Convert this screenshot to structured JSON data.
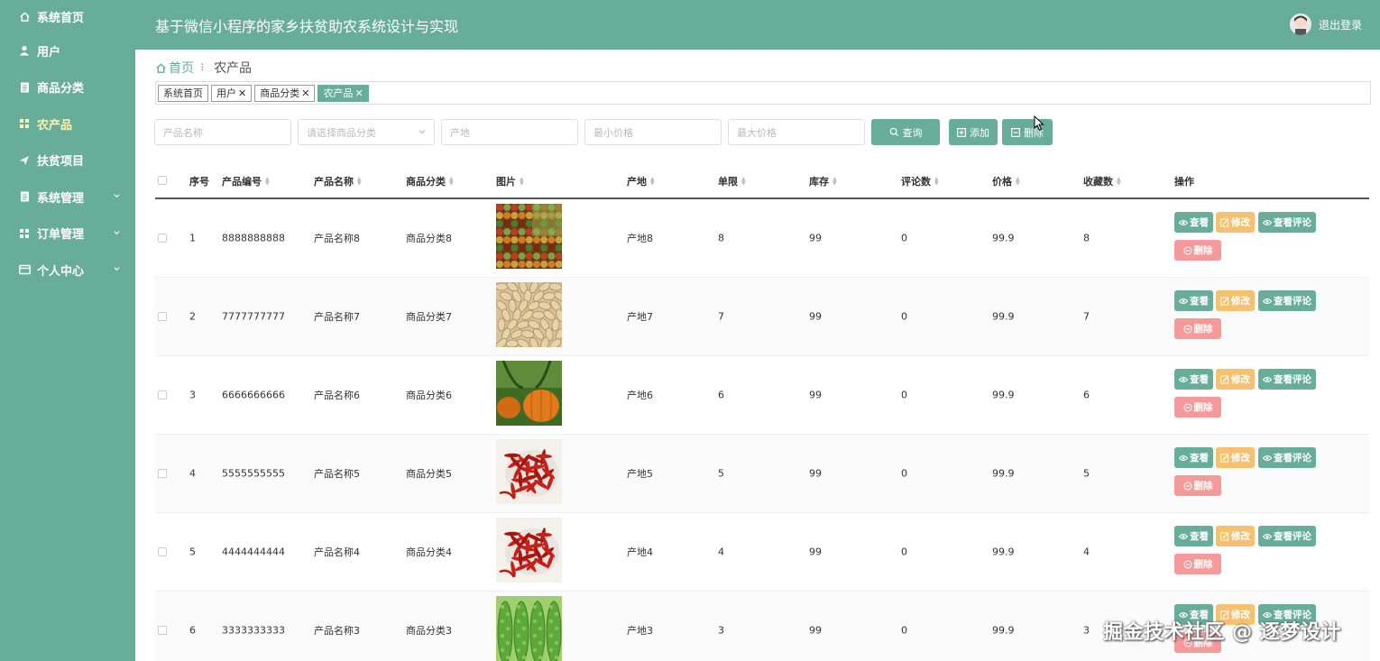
{
  "sidebar": {
    "items": [
      {
        "label": "系统首页",
        "icon": "home-icon",
        "active": false
      },
      {
        "label": "用户",
        "icon": "user-icon",
        "active": false
      },
      {
        "label": "商品分类",
        "icon": "doc-icon",
        "active": false
      },
      {
        "label": "农产品",
        "icon": "grid-icon",
        "active": true
      },
      {
        "label": "扶贫项目",
        "icon": "send-icon",
        "active": false
      },
      {
        "label": "系统管理",
        "icon": "doc-icon",
        "active": false,
        "expandable": true
      },
      {
        "label": "订单管理",
        "icon": "grid-icon",
        "active": false,
        "expandable": true
      },
      {
        "label": "个人中心",
        "icon": "card-icon",
        "active": false,
        "expandable": true
      }
    ]
  },
  "header": {
    "title": "基于微信小程序的家乡扶贫助农系统设计与实现",
    "logout": "退出登录"
  },
  "breadcrumb": {
    "home": "首页",
    "current": "农产品"
  },
  "tags": [
    {
      "label": "系统首页",
      "closable": false,
      "active": false
    },
    {
      "label": "用户",
      "closable": true,
      "active": false
    },
    {
      "label": "商品分类",
      "closable": true,
      "active": false
    },
    {
      "label": "农产品",
      "closable": true,
      "active": true
    }
  ],
  "search": {
    "name_placeholder": "产品名称",
    "category_placeholder": "请选择商品分类",
    "origin_placeholder": "产地",
    "min_price_placeholder": "最小价格",
    "max_price_placeholder": "最大价格",
    "query_label": "查询",
    "add_label": "添加",
    "delete_label": "删除"
  },
  "table": {
    "headers": [
      "序号",
      "产品编号",
      "产品名称",
      "商品分类",
      "图片",
      "产地",
      "单限",
      "库存",
      "评论数",
      "价格",
      "收藏数",
      "操作"
    ],
    "actions": {
      "view": "查看",
      "edit": "修改",
      "comments": "查看评论",
      "delete": "删除"
    },
    "rows": [
      {
        "idx": "1",
        "code": "8888888888",
        "name": "产品名称8",
        "category": "商品分类8",
        "image": "mixed-vegetables",
        "origin": "产地8",
        "limit": "8",
        "stock": "99",
        "comments": "0",
        "price": "99.9",
        "favorites": "8"
      },
      {
        "idx": "2",
        "code": "7777777777",
        "name": "产品名称7",
        "category": "商品分类7",
        "image": "peanuts",
        "origin": "产地7",
        "limit": "7",
        "stock": "99",
        "comments": "0",
        "price": "99.9",
        "favorites": "7"
      },
      {
        "idx": "3",
        "code": "6666666666",
        "name": "产品名称6",
        "category": "商品分类6",
        "image": "pumpkins",
        "origin": "产地6",
        "limit": "6",
        "stock": "99",
        "comments": "0",
        "price": "99.9",
        "favorites": "6"
      },
      {
        "idx": "4",
        "code": "5555555555",
        "name": "产品名称5",
        "category": "商品分类5",
        "image": "red-chili",
        "origin": "产地5",
        "limit": "5",
        "stock": "99",
        "comments": "0",
        "price": "99.9",
        "favorites": "5"
      },
      {
        "idx": "5",
        "code": "4444444444",
        "name": "产品名称4",
        "category": "商品分类4",
        "image": "red-chili",
        "origin": "产地4",
        "limit": "4",
        "stock": "99",
        "comments": "0",
        "price": "99.9",
        "favorites": "4"
      },
      {
        "idx": "6",
        "code": "3333333333",
        "name": "产品名称3",
        "category": "商品分类3",
        "image": "bitter-melon",
        "origin": "产地3",
        "limit": "3",
        "stock": "99",
        "comments": "0",
        "price": "99.9",
        "favorites": "3"
      }
    ]
  },
  "watermark": "掘金技术社区 @ 逐梦设计",
  "colors": {
    "primary": "#68ad9a",
    "edit": "#f5c070",
    "delete": "#f59a9a",
    "active_menu": "#fff3b0"
  }
}
